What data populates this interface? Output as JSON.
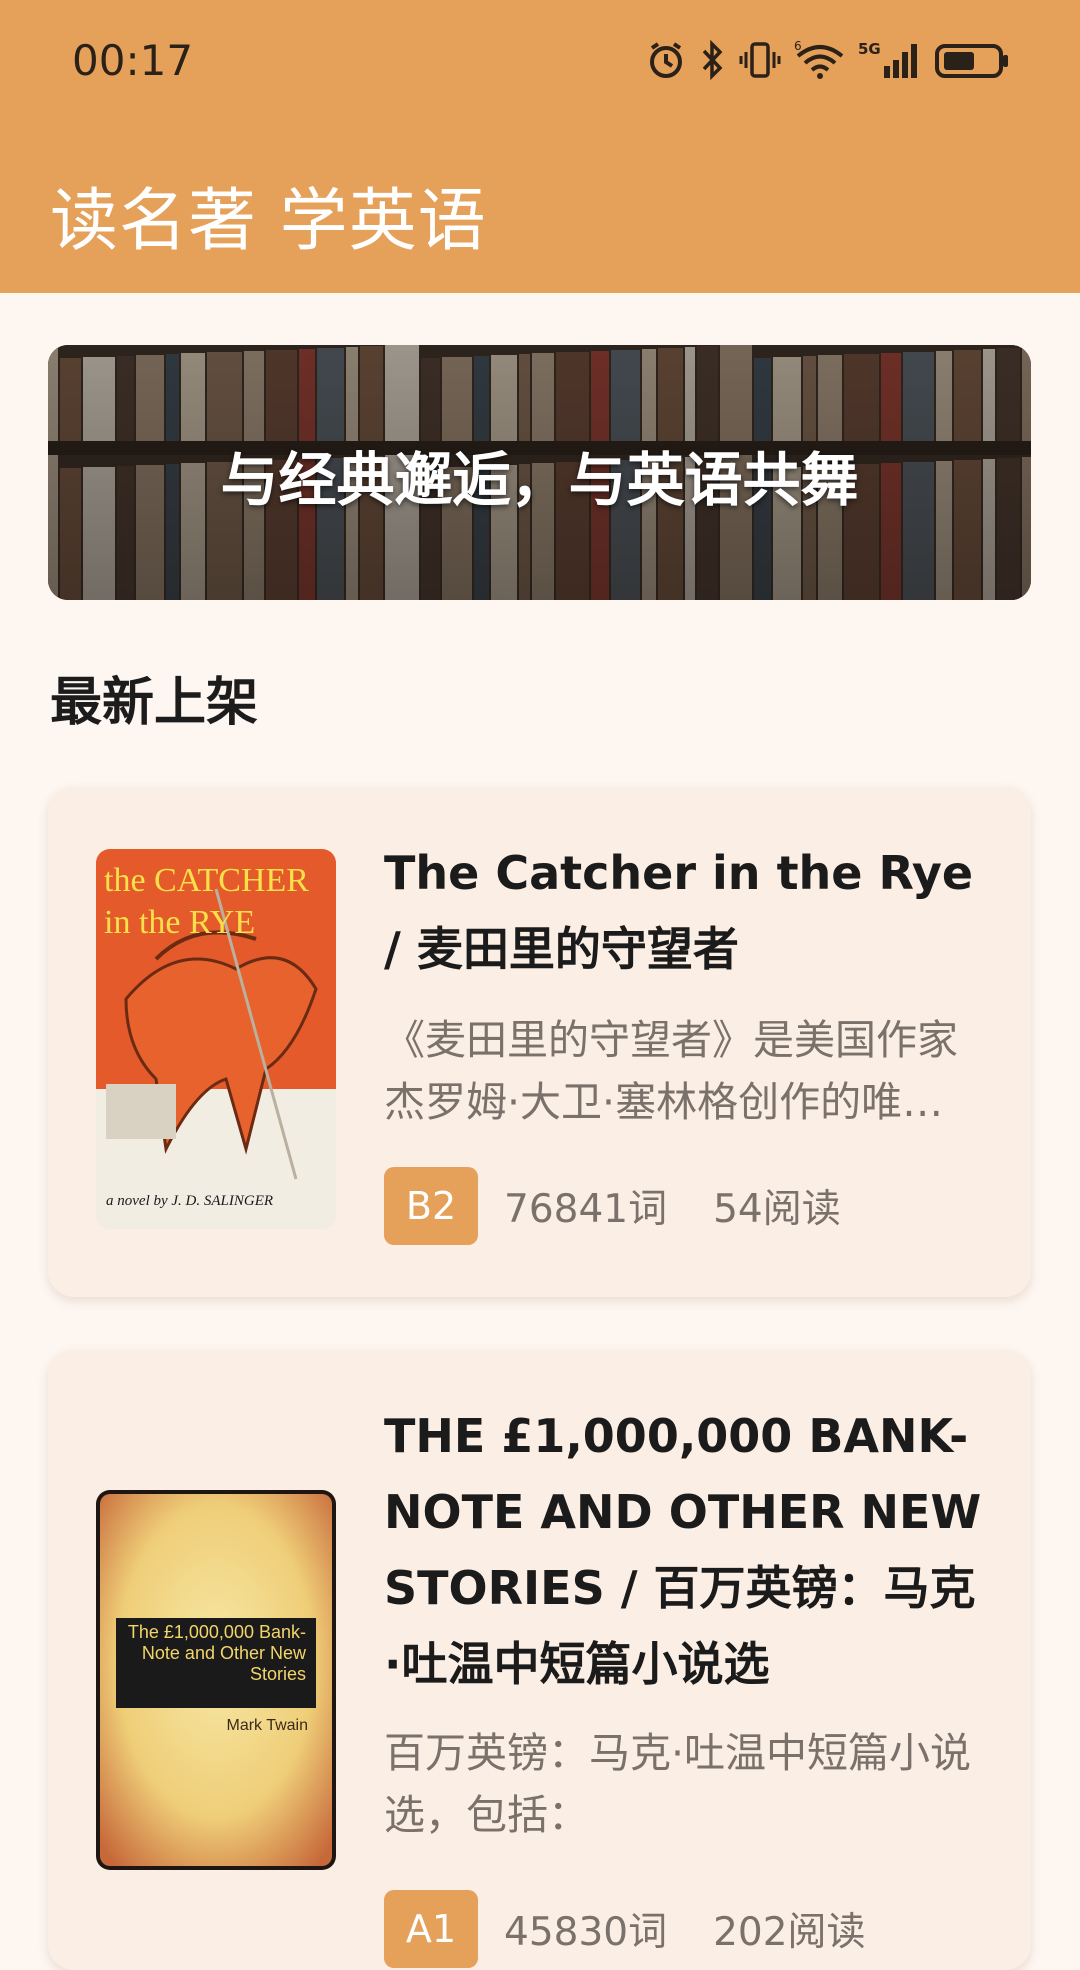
{
  "status_bar": {
    "time": "00:17",
    "icons": [
      "alarm-icon",
      "bluetooth-icon",
      "vibrate-icon",
      "wifi-icon",
      "signal-5g-icon",
      "battery-icon"
    ],
    "network_label": "5G",
    "wifi_label": "6"
  },
  "header": {
    "title": "读名著 学英语",
    "color": "#e5a05a"
  },
  "banner": {
    "text": "与经典邂逅，与英语共舞"
  },
  "section": {
    "title": "最新上架"
  },
  "books": [
    {
      "title": "The Catcher in the Rye / 麦田里的守望者",
      "description": "《麦田里的守望者》是美国作家杰罗姆·大卫·塞林格创作的唯…",
      "level": "B2",
      "words": "76841词",
      "reads": "54阅读",
      "cover": {
        "line1": "the CATCHER",
        "line2": "in the RYE",
        "author": "a novel by J. D. SALINGER"
      }
    },
    {
      "title": "THE £1,000,000 BANK-NOTE AND OTHER NEW STORIES / 百万英镑：马克·吐温中短篇小说选",
      "description": "百万英镑：马克·吐温中短篇小说选，包括：",
      "level": "A1",
      "words": "45830词",
      "reads": "202阅读",
      "cover": {
        "title": "The £1,000,000 Bank-Note and Other New Stories",
        "author": "Mark Twain"
      }
    }
  ],
  "colors": {
    "accent": "#e5a05a",
    "card_bg": "#fbeee5",
    "page_bg": "#fdf6f1"
  }
}
